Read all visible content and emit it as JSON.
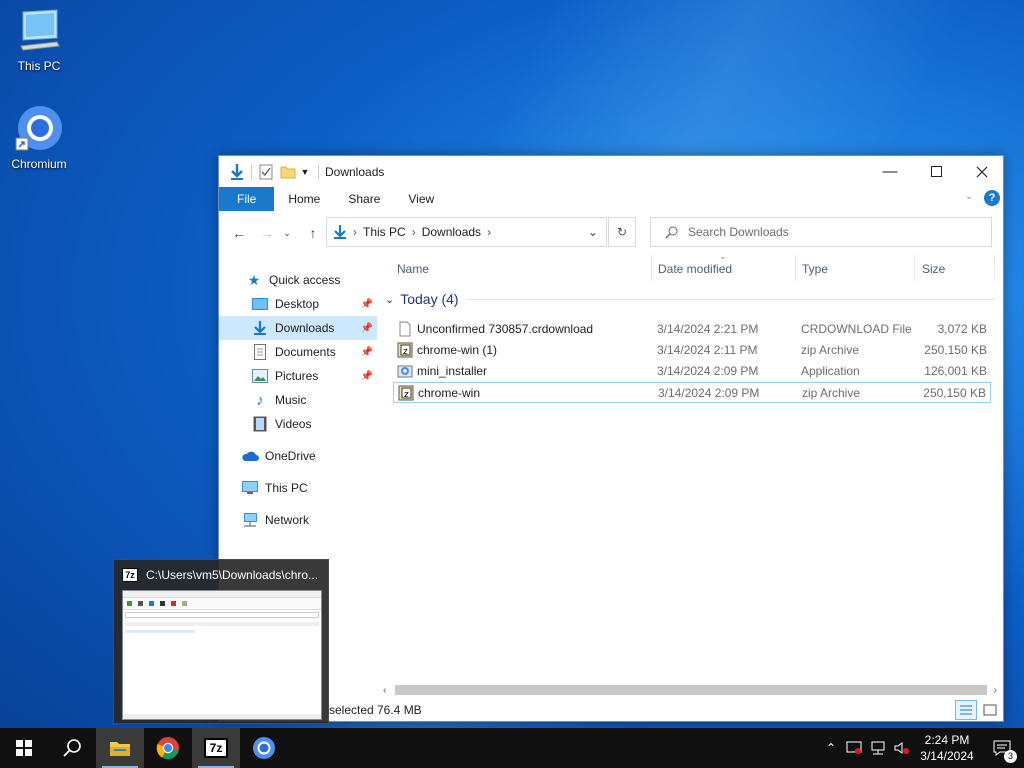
{
  "desktop": {
    "icons": [
      {
        "label": "This PC"
      },
      {
        "label": "Chromium"
      }
    ]
  },
  "explorer": {
    "title": "Downloads",
    "ribbon_tabs": [
      "File",
      "Home",
      "Share",
      "View"
    ],
    "path": [
      "This PC",
      "Downloads"
    ],
    "search_placeholder": "Search Downloads",
    "nav": {
      "quick_access": "Quick access",
      "items": [
        "Desktop",
        "Downloads",
        "Documents",
        "Pictures",
        "Music",
        "Videos"
      ],
      "onedrive": "OneDrive",
      "this_pc": "This PC",
      "network": "Network"
    },
    "columns": [
      "Name",
      "Date modified",
      "Type",
      "Size"
    ],
    "group": "Today (4)",
    "files": [
      {
        "name": "Unconfirmed 730857.crdownload",
        "date": "3/14/2024 2:21 PM",
        "type": "CRDOWNLOAD File",
        "size": "3,072 KB"
      },
      {
        "name": "chrome-win (1)",
        "date": "3/14/2024 2:11 PM",
        "type": "zip Archive",
        "size": "250,150 KB"
      },
      {
        "name": "mini_installer",
        "date": "3/14/2024 2:09 PM",
        "type": "Application",
        "size": "126,001 KB"
      },
      {
        "name": "chrome-win",
        "date": "3/14/2024 2:09 PM",
        "type": "zip Archive",
        "size": "250,150 KB"
      }
    ],
    "status": {
      "selected": "selected",
      "size": "76.4 MB"
    }
  },
  "thumbnail": {
    "title": "C:\\Users\\vm5\\Downloads\\chro..."
  },
  "taskbar": {
    "time": "2:24 PM",
    "date": "3/14/2024",
    "notification_count": "3"
  },
  "colors": {
    "accent": "#1979ca",
    "selection": "#cce8ff",
    "taskbar": "#101010"
  }
}
